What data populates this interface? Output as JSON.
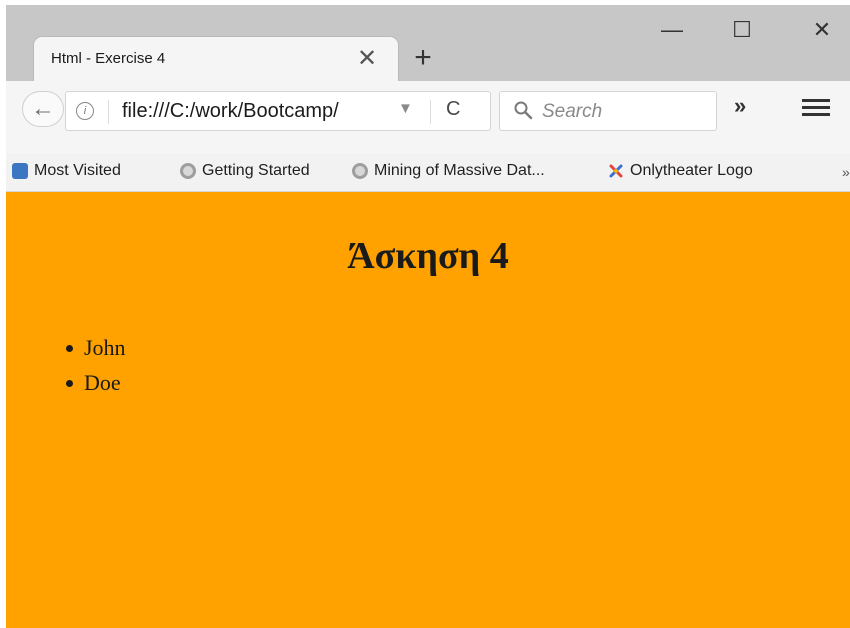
{
  "browser": {
    "tab": {
      "title": "Html - Exercise 4",
      "close_glyph": "✕"
    },
    "new_tab_glyph": "+",
    "window_controls": {
      "minimize": "—",
      "maximize": "☐",
      "close": "✕"
    },
    "nav": {
      "back_glyph": "←",
      "info_glyph": "i",
      "url": "file:///C:/work/Bootcamp/",
      "dropdown_glyph": "▼",
      "reload_glyph": "C",
      "search_placeholder": "Search",
      "overflow_glyph": "»"
    },
    "bookmarks": [
      {
        "label": "Most Visited",
        "icon": "most-visited-icon"
      },
      {
        "label": "Getting Started",
        "icon": "globe-icon"
      },
      {
        "label": "Mining of Massive Dat...",
        "icon": "globe-icon"
      },
      {
        "label": "Onlytheater Logo",
        "icon": "logo-icon"
      }
    ],
    "bookmarks_chevron": "»"
  },
  "page": {
    "heading": "Άσκηση 4",
    "items": [
      "John",
      "Doe"
    ],
    "background_color": "#ffa200"
  }
}
